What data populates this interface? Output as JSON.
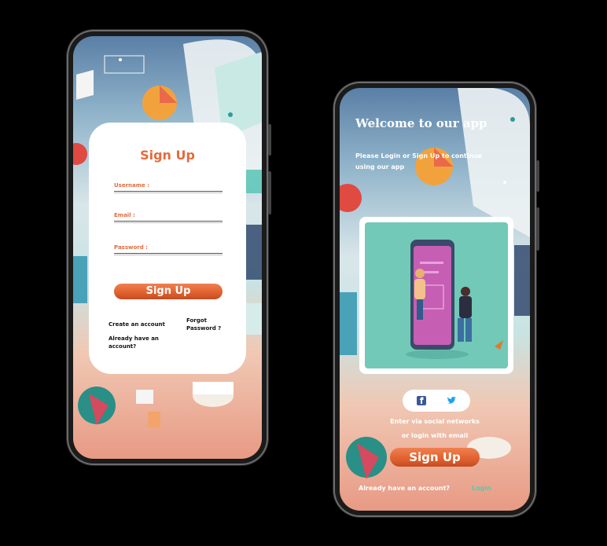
{
  "signup_screen": {
    "title": "Sign Up",
    "fields": [
      {
        "label": "Username :"
      },
      {
        "label": "Email :"
      },
      {
        "label": "Password :"
      }
    ],
    "submit_label": "Sign Up",
    "create_account": "Create an account",
    "forgot_password": "Forgot Password ?",
    "already_account": "Already have an account?"
  },
  "welcome_screen": {
    "title": "Welcome to our app",
    "subtitle": "Please Login or Sign Up to continue using our app",
    "social_hint_line1": "Enter via social networks",
    "social_hint_line2": "or login with email",
    "signup_label": "Sign Up",
    "already_text": "Already have an account?",
    "login_label": "Login",
    "icons": [
      "facebook-icon",
      "twitter-icon"
    ]
  },
  "colors": {
    "accent": "#e56a3c",
    "teal": "#72c9b8",
    "login_link": "#3fd3b8"
  }
}
